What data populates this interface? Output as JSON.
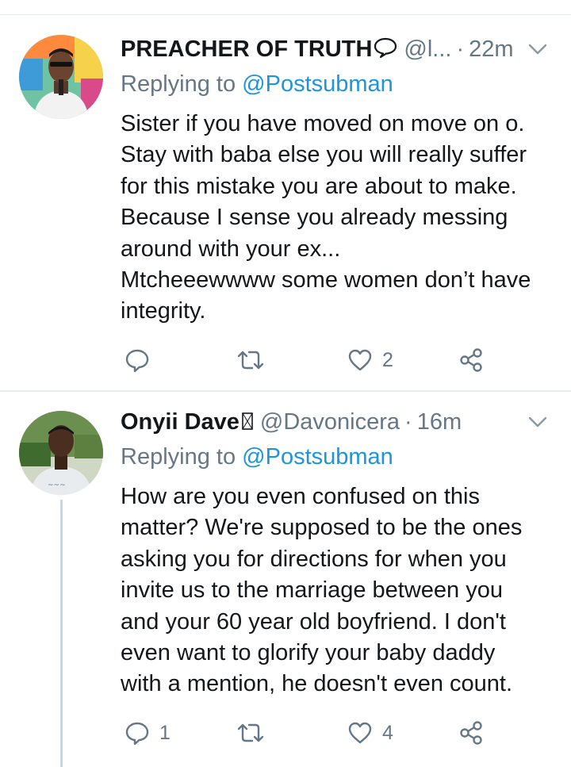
{
  "colors": {
    "text": "#14171a",
    "secondary": "#657786",
    "link": "#1b95e0",
    "divider": "#e6ecf0",
    "thread_line": "#ccd6dd"
  },
  "tweets": [
    {
      "display_name": "PREACHER OF TRUTH",
      "name_emoji_icon": "speech-balloon-icon",
      "handle": "@l...",
      "separator": "·",
      "time": "22m",
      "replying_prefix": "Replying to",
      "replying_to": "@Postsubman",
      "body_lines": [
        "Sister if you have moved on move on o.",
        "Stay with baba else you will really suffer",
        "for this mistake you are about to make.",
        "Because I sense you already messing",
        "around with your ex...",
        "Mtcheeewwww some women don’t have",
        "integrity."
      ],
      "reply_count": "",
      "retweet_count": "",
      "like_count": "2",
      "icons": [
        "reply-icon",
        "retweet-icon",
        "like-icon",
        "share-icon",
        "chevron-down-icon"
      ]
    },
    {
      "display_name": "Onyii Dave",
      "name_emoji_icon": "missing-glyph-icon",
      "handle": "@Davonicera",
      "separator": "·",
      "time": "16m",
      "replying_prefix": "Replying to",
      "replying_to": "@Postsubman",
      "body_lines": [
        "How are you even confused on this",
        "matter? We're supposed to be the ones",
        "asking you for directions for when you",
        "invite us to the marriage between you",
        "and your 60 year old boyfriend. I don't",
        "even want to glorify your baby daddy",
        "with a mention, he doesn't even count."
      ],
      "reply_count": "1",
      "retweet_count": "",
      "like_count": "4",
      "icons": [
        "reply-icon",
        "retweet-icon",
        "like-icon",
        "share-icon",
        "chevron-down-icon"
      ]
    }
  ]
}
